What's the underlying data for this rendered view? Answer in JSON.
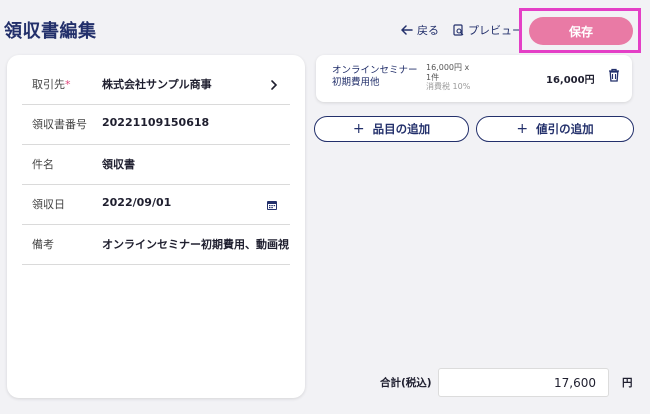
{
  "header": {
    "title": "領収書編集",
    "back_label": "戻る",
    "preview_label": "プレビュー",
    "save_label": "保存"
  },
  "form": {
    "rows": [
      {
        "label": "取引先",
        "required_mark": "*",
        "value": "株式会社サンプル商事",
        "icon": "chevron-right-icon"
      },
      {
        "label": "領収書番号",
        "value": "20221109150618"
      },
      {
        "label": "件名",
        "value": "領収書"
      },
      {
        "label": "領収日",
        "value": "2022/09/01",
        "icon": "calendar-icon"
      },
      {
        "label": "備考",
        "value": "オンラインセミナー初期費用、動画視"
      }
    ]
  },
  "items": [
    {
      "name_line1": "オンラインセミナー",
      "name_line2": "初期費用他",
      "unit_price": "16,000円 x",
      "quantity": "1件",
      "tax": "消費税 10%",
      "amount": "16,000円"
    }
  ],
  "actions": {
    "add_item_label": "品目の追加",
    "add_discount_label": "値引の追加"
  },
  "total": {
    "label": "合計(税込)",
    "value": "17,600",
    "unit": "円"
  },
  "colors": {
    "primary": "#23306b",
    "save_button": "#e97aa5",
    "highlight": "#e43fc6",
    "required": "#e0457b"
  }
}
